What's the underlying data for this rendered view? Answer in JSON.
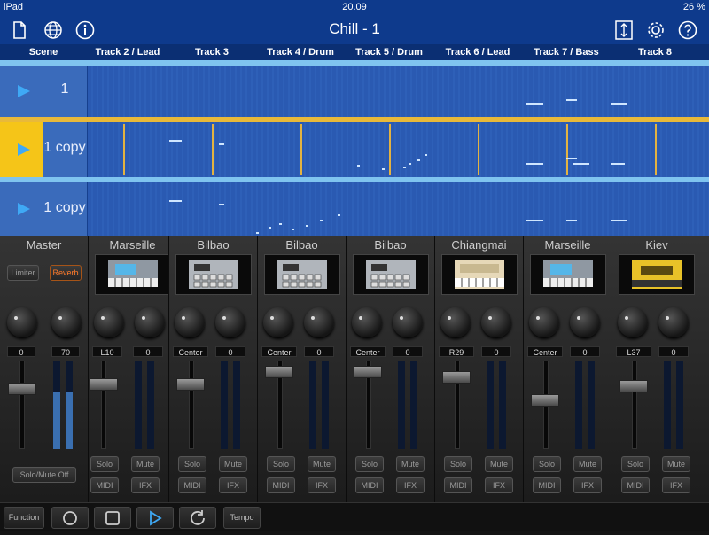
{
  "status": {
    "device": "iPad",
    "time": "20.09",
    "battery": "26 %"
  },
  "title": "Chill - 1",
  "scene_header": "Scene",
  "tracks": [
    "Track 2 / Lead",
    "Track 3",
    "Track 4 / Drum",
    "Track 5 / Drum",
    "Track 6 / Lead",
    "Track 7 / Bass",
    "Track 8"
  ],
  "scenes": [
    "1",
    "1 copy",
    "1 copy"
  ],
  "master": {
    "name": "Master",
    "limiter": "Limiter",
    "reverb": "Reverb",
    "val1": "0",
    "val2": "70",
    "solo_mute": "Solo/Mute Off"
  },
  "strips": [
    {
      "name": "Marseille",
      "pan": "L10",
      "vol": "0"
    },
    {
      "name": "Bilbao",
      "pan": "Center",
      "vol": "0"
    },
    {
      "name": "Bilbao",
      "pan": "Center",
      "vol": "0"
    },
    {
      "name": "Bilbao",
      "pan": "Center",
      "vol": "0"
    },
    {
      "name": "Chiangmai",
      "pan": "R29",
      "vol": "0"
    },
    {
      "name": "Marseille",
      "pan": "Center",
      "vol": "0"
    },
    {
      "name": "Kiev",
      "pan": "L37",
      "vol": "0"
    }
  ],
  "strip_buttons": {
    "solo": "Solo",
    "mute": "Mute",
    "midi": "MIDI",
    "ifx": "IFX"
  },
  "transport": {
    "function": "Function",
    "tempo": "Tempo"
  },
  "colors": {
    "accent": "#0e3a8c",
    "scene_active": "#f5c518",
    "play": "#3fa9f5",
    "clip_bar": "#7fc4ef"
  }
}
